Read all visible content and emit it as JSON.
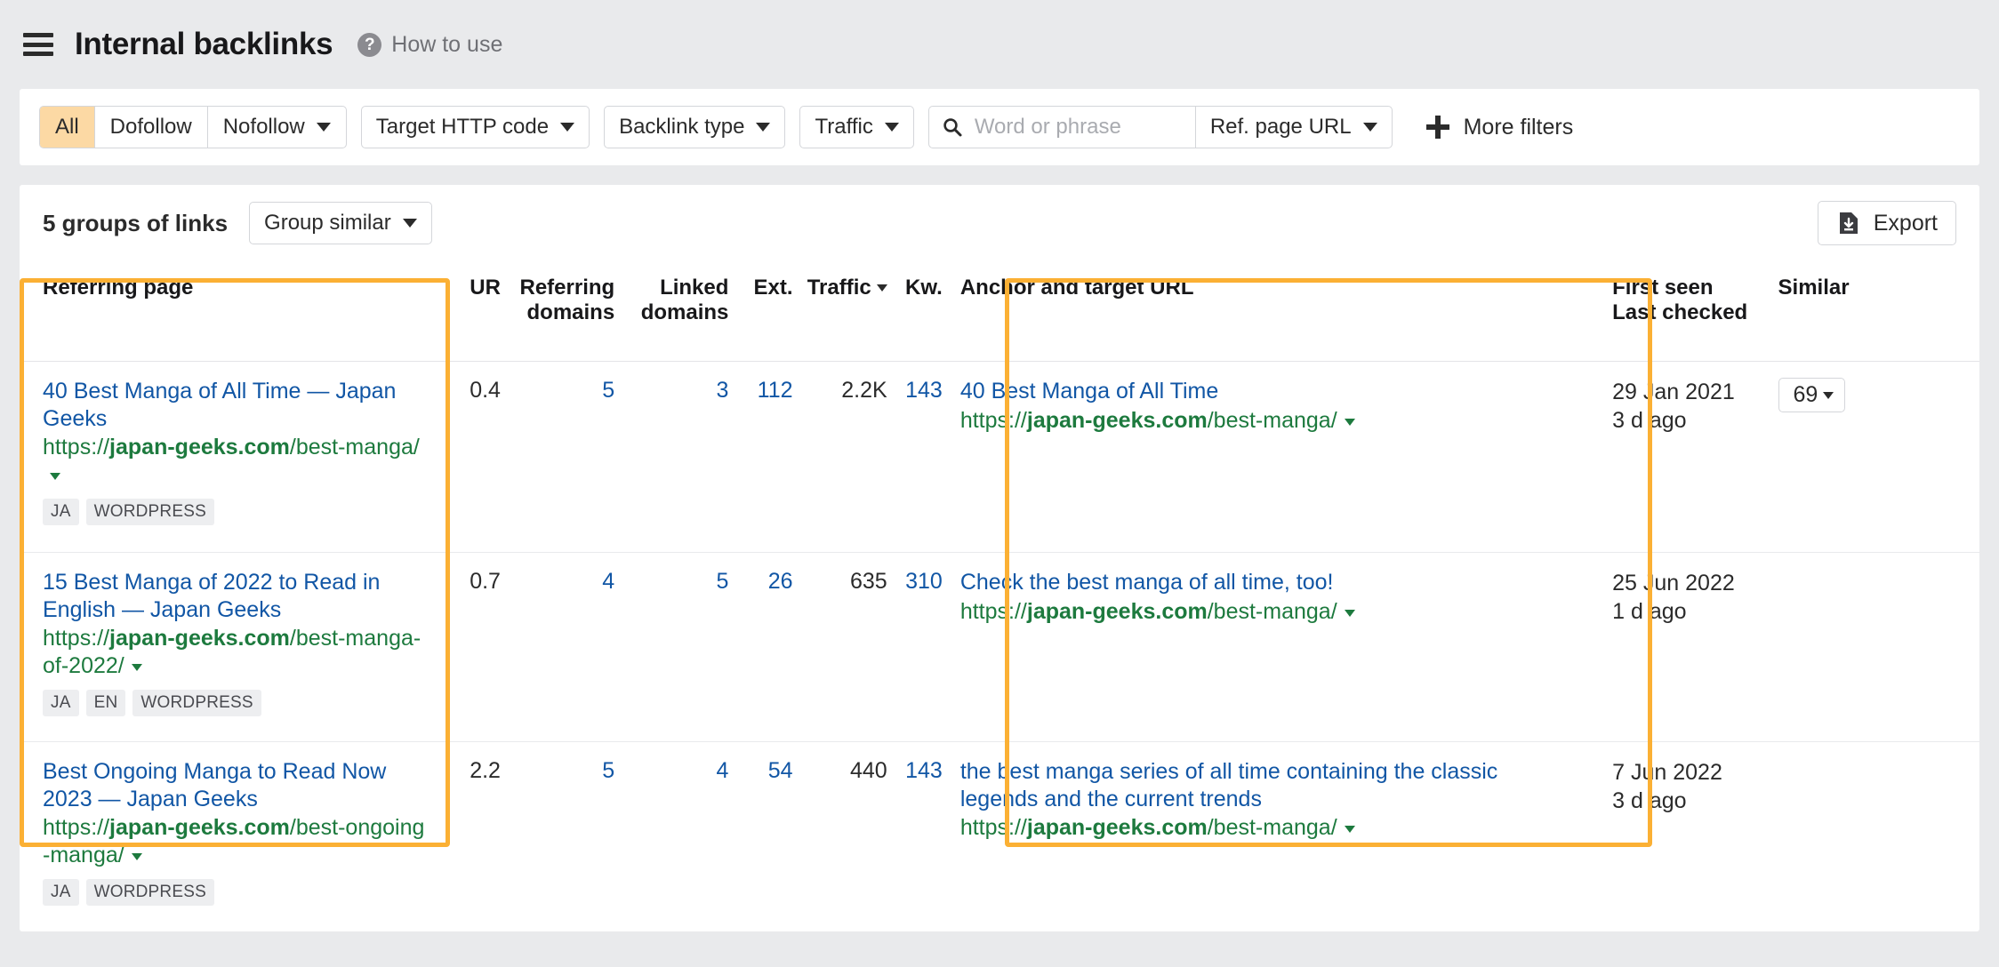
{
  "header": {
    "menu_icon": "hamburger-icon",
    "title": "Internal backlinks",
    "help_icon": "question-mark-icon",
    "help_label": "How to use"
  },
  "filters": {
    "segment": [
      {
        "label": "All",
        "active": true,
        "caret": false
      },
      {
        "label": "Dofollow",
        "active": false,
        "caret": false
      },
      {
        "label": "Nofollow",
        "active": false,
        "caret": true
      }
    ],
    "dropdowns": [
      {
        "label": "Target HTTP code"
      },
      {
        "label": "Backlink type"
      },
      {
        "label": "Traffic"
      }
    ],
    "search": {
      "icon": "search-icon",
      "placeholder": "Word or phrase",
      "value": ""
    },
    "ref_page_url": {
      "label": "Ref. page URL"
    },
    "more_filters": {
      "icon": "plus-icon",
      "label": "More filters"
    }
  },
  "toolbar": {
    "groups_count": "5 groups of links",
    "group_similar": "Group similar",
    "export_label": "Export",
    "export_icon": "download-file-icon"
  },
  "table": {
    "columns": [
      {
        "label": "Referring page",
        "align": "left"
      },
      {
        "label": "UR",
        "align": "right"
      },
      {
        "label": "Referring domains",
        "align": "right"
      },
      {
        "label": "Linked domains",
        "align": "right"
      },
      {
        "label": "Ext.",
        "align": "right"
      },
      {
        "label": "Traffic",
        "align": "right",
        "sorted": true
      },
      {
        "label": "Kw.",
        "align": "right"
      },
      {
        "label": "Anchor and target URL",
        "align": "left"
      },
      {
        "label": "First seen",
        "sub": "Last checked",
        "align": "left"
      },
      {
        "label": "Similar",
        "align": "left"
      }
    ],
    "rows": [
      {
        "referring_page": {
          "title": "40 Best Manga of All Time — Japan Geeks",
          "url_prefix": "https://",
          "url_domain": "japan-geeks.com",
          "url_path": "/best-manga/",
          "badges": [
            "JA",
            "WORDPRESS"
          ]
        },
        "ur": "0.4",
        "referring_domains": "5",
        "linked_domains": "3",
        "ext": "112",
        "traffic": "2.2K",
        "kw": "143",
        "anchor": {
          "text": "40 Best Manga of All Time",
          "url_prefix": "https://",
          "url_domain": "japan-geeks.com",
          "url_path": "/best-manga/"
        },
        "first_seen": "29 Jan 2021",
        "last_checked": "3 d ago",
        "similar": "69"
      },
      {
        "referring_page": {
          "title": "15 Best Manga of 2022 to Read in English — Japan Geeks",
          "url_prefix": "https://",
          "url_domain": "japan-geeks.com",
          "url_path": "/best-manga-of-2022/",
          "badges": [
            "JA",
            "EN",
            "WORDPRESS"
          ]
        },
        "ur": "0.7",
        "referring_domains": "4",
        "linked_domains": "5",
        "ext": "26",
        "traffic": "635",
        "kw": "310",
        "anchor": {
          "text": "Check the best manga of all time, too!",
          "url_prefix": "https://",
          "url_domain": "japan-geeks.com",
          "url_path": "/best-manga/"
        },
        "first_seen": "25 Jun 2022",
        "last_checked": "1 d ago",
        "similar": ""
      },
      {
        "referring_page": {
          "title": "Best Ongoing Manga to Read Now 2023 — Japan Geeks",
          "url_prefix": "https://",
          "url_domain": "japan-geeks.com",
          "url_path": "/best-ongoing-manga/",
          "badges": [
            "JA",
            "WORDPRESS"
          ]
        },
        "ur": "2.2",
        "referring_domains": "5",
        "linked_domains": "4",
        "ext": "54",
        "traffic": "440",
        "kw": "143",
        "anchor": {
          "text": "the best manga series of all time containing the classic legends and the current trends",
          "url_prefix": "https://",
          "url_domain": "japan-geeks.com",
          "url_path": "/best-manga/"
        },
        "first_seen": "7 Jun 2022",
        "last_checked": "3 d ago",
        "similar": ""
      }
    ]
  },
  "highlights": {
    "color": "#fbb034",
    "boxes": [
      {
        "name": "referring-page-highlight"
      },
      {
        "name": "anchor-and-target-url-highlight"
      }
    ]
  }
}
